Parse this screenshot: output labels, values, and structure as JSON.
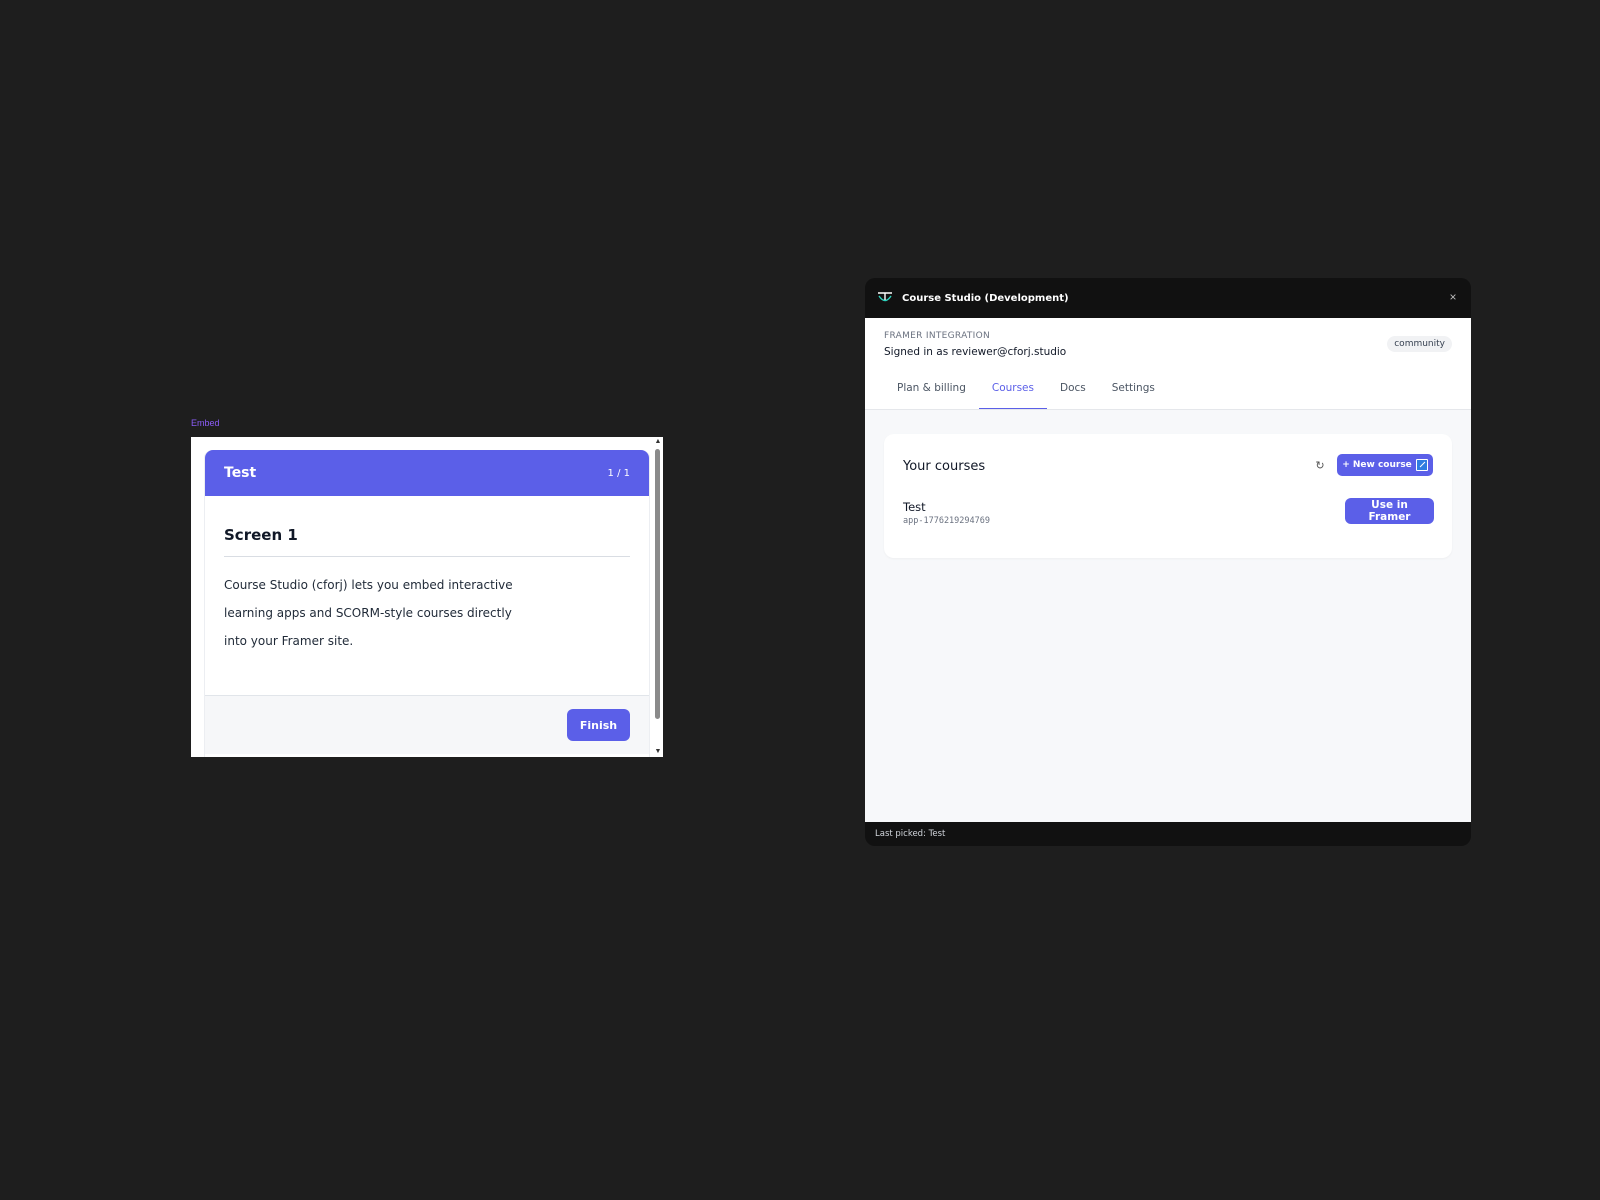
{
  "canvas": {
    "embed_label": "Embed"
  },
  "embed": {
    "course_title": "Test",
    "progress": "1 / 1",
    "screen_title": "Screen 1",
    "screen_text": "Course Studio (cforj) lets you embed interactive learning apps and SCORM-style courses directly into your Framer site.",
    "finish_label": "Finish"
  },
  "plugin": {
    "title": "Course Studio (Development)",
    "close_icon": "×",
    "kicker": "FRAMER INTEGRATION",
    "signed_in": "Signed in as reviewer@cforj.studio",
    "plan_badge": "community",
    "tabs": [
      {
        "label": "Plan & billing",
        "active": false
      },
      {
        "label": "Courses",
        "active": true
      },
      {
        "label": "Docs",
        "active": false
      },
      {
        "label": "Settings",
        "active": false
      }
    ],
    "courses_card": {
      "title": "Your courses",
      "refresh_icon": "↻",
      "new_course_label": "+ New course",
      "items": [
        {
          "name": "Test",
          "id": "app-1776219294769",
          "action_label": "Use in Framer"
        }
      ]
    },
    "status": "Last picked: Test"
  },
  "colors": {
    "canvas_bg": "#1e1e1e",
    "accent": "#5b5fe8",
    "embed_label": "#8b5cf6"
  }
}
